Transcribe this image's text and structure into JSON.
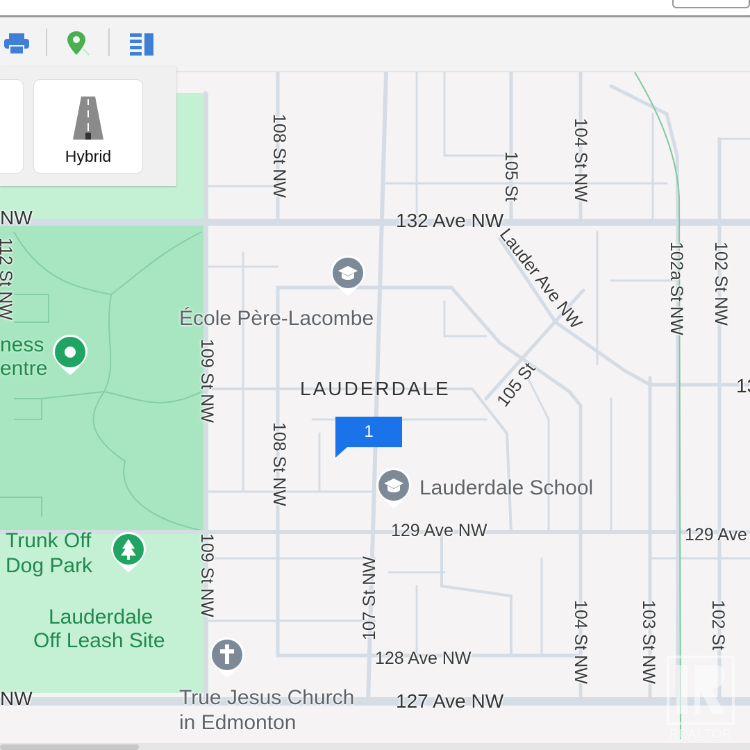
{
  "toolbar": {
    "icons": [
      "print-icon",
      "map-pin-icon",
      "list-panel-icon"
    ]
  },
  "map_type": {
    "hybrid_label": "Hybrid"
  },
  "neighbourhood": "LAUDERDALE",
  "roads": {
    "r132": "132 Ave NW",
    "r129": "129 Ave NW",
    "r129_right": "129 Ave",
    "r128": "128 Ave NW",
    "r127": "127 Ave NW",
    "left_nw_top": "NW",
    "left_nw_bottom": "NW",
    "s112": "112 St NW",
    "s109_top": "109 St NW",
    "s109_bottom": "109 St NW",
    "s108_top": "108 St NW",
    "s108_mid": "108 St NW",
    "s107": "107 St NW",
    "s105_top": "105 St",
    "s105_diag": "105 St",
    "lauder_ave": "Lauder Ave NW",
    "s104_top": "104 St NW",
    "s104_bottom": "104 St NW",
    "s103": "103 St NW",
    "s102a": "102a St NW",
    "s102_top": "102 St NW",
    "s102_bottom": "102 St",
    "edge_13": "13"
  },
  "pois": {
    "ecole": "École Père-Lacombe",
    "lauderdale_school": "Lauderdale School",
    "fitness_line1": "ness",
    "fitness_line2": "entre",
    "dog_park_line1": "Trunk Off",
    "dog_park_line2": "Dog Park",
    "off_leash_line1": "Lauderdale",
    "off_leash_line2": "Off Leash Site",
    "church_line1": "True Jesus Church",
    "church_line2": "in Edmonton"
  },
  "listing_marker": {
    "count": "1"
  },
  "watermark": {
    "text": "REALTOR"
  },
  "colors": {
    "park": "#a8e6c1",
    "park_light": "#c4f0d4",
    "road": "#d4dbe3",
    "marker": "#1a73e8",
    "poi_gray": "#7b8a96",
    "poi_green": "#1fa463"
  }
}
